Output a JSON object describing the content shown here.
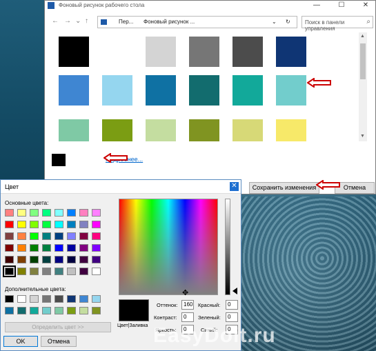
{
  "background_window": {
    "title": "Фоновый рисунок рабочего стола",
    "controls": {
      "minimize": "—",
      "maximize": "☐",
      "close": "✕"
    },
    "nav": {
      "back": "←",
      "forward": "→",
      "down": "⌄",
      "up": "↑"
    },
    "breadcrumb": [
      "Пер...",
      "Фоновый рисунок ..."
    ],
    "breadcrumb_dropdown": "⌄",
    "refresh": "↻",
    "search_placeholder": "Поиск в панели управления",
    "swatches": [
      [
        "#000000",
        "#ffffff",
        "#d4d4d4",
        "#767676",
        "#4c4c4c",
        "#0f3574"
      ],
      [
        "#3f86d2",
        "#95d6ef",
        "#0f71a3",
        "#126c6e",
        "#12a99a",
        "#72cdcc"
      ],
      [
        "#7fc9a5",
        "#7b9d13",
        "#c4dda0",
        "#809421",
        "#d7d977",
        "#f7e969"
      ]
    ],
    "current_color": "#000000",
    "more_link": "Подробнее...",
    "save_button": "Сохранить изменения",
    "cancel_button": "Отмена"
  },
  "color_dialog": {
    "title": "Цвет",
    "close": "✕",
    "basic_colors_label": "Основные цвета:",
    "basic_colors": [
      "#ff8080",
      "#ffff80",
      "#80ff80",
      "#00ff80",
      "#80ffff",
      "#0080ff",
      "#ff80c0",
      "#ff80ff",
      "#ff0000",
      "#ffff00",
      "#80ff00",
      "#00ff40",
      "#00ffff",
      "#0080c0",
      "#8080c0",
      "#ff00ff",
      "#804040",
      "#ff8040",
      "#00ff00",
      "#008080",
      "#004080",
      "#8080ff",
      "#800040",
      "#ff0080",
      "#800000",
      "#ff8000",
      "#008000",
      "#008040",
      "#0000ff",
      "#0000a0",
      "#800080",
      "#8000ff",
      "#400000",
      "#804000",
      "#004000",
      "#004040",
      "#000080",
      "#000040",
      "#400040",
      "#400080",
      "#000000",
      "#808000",
      "#808040",
      "#808080",
      "#408080",
      "#c0c0c0",
      "#400040",
      "#ffffff"
    ],
    "custom_colors_label": "Дополнительные цвета:",
    "custom_colors": [
      "#000000",
      "#ffffff",
      "#d4d4d4",
      "#767676",
      "#4c4c4c",
      "#0f3574",
      "#3f86d2",
      "#95d6ef",
      "#0f71a3",
      "#126c6e",
      "#12a99a",
      "#72cdcc",
      "#7fc9a5",
      "#7b9d13",
      "#c4dda0",
      "#809421"
    ],
    "define_button": "Определить цвет >>",
    "ok_button": "OK",
    "cancel_button": "Отмена",
    "preview_label": "Цвет|Заливка",
    "hue_label": "Оттенок:",
    "hue_value": "160",
    "sat_label": "Контраст:",
    "sat_value": "0",
    "lum_label": "Яркость:",
    "lum_value": "0",
    "red_label": "Красный:",
    "red_value": "0",
    "green_label": "Зеленый:",
    "green_value": "0",
    "blue_label": "Синий:",
    "blue_value": "0"
  },
  "watermark": "EasyDoit.ru",
  "colors": {
    "annotation_red": "#cc0000",
    "link": "#0066cc",
    "close_blue": "#1e6fd0"
  }
}
